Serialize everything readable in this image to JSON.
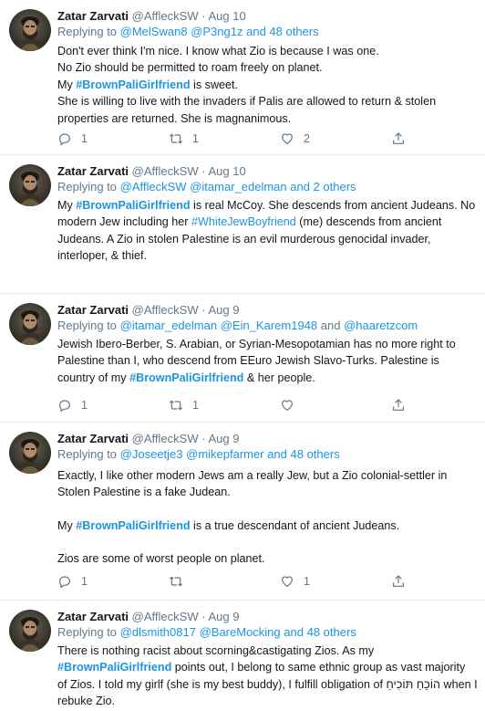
{
  "tweets": [
    {
      "name": "Zatar Zarvati",
      "handle": "@AffleckSW",
      "dot": "·",
      "date": "Aug 10",
      "reply_prefix": "Replying to ",
      "reply_users": [
        "@MelSwan8",
        "@P3ng1z"
      ],
      "reply_suffix": "and 48 others",
      "replies": "1",
      "retweets": "1",
      "likes": "2"
    },
    {
      "name": "Zatar Zarvati",
      "handle": "@AffleckSW",
      "dot": "·",
      "date": "Aug 10",
      "reply_prefix": "Replying to ",
      "reply_users": [
        "@AffleckSW",
        "@itamar_edelman"
      ],
      "reply_suffix": "and 2 others"
    },
    {
      "name": "Zatar Zarvati",
      "handle": "@AffleckSW",
      "dot": "·",
      "date": "Aug 9",
      "reply_prefix": "Replying to ",
      "reply_users": [
        "@itamar_edelman",
        "@Ein_Karem1948"
      ],
      "reply_and": "and",
      "reply_last": "@haaretzcom",
      "replies": "1",
      "retweets": "1",
      "likes": ""
    },
    {
      "name": "Zatar Zarvati",
      "handle": "@AffleckSW",
      "dot": "·",
      "date": "Aug 9",
      "reply_prefix": "Replying to ",
      "reply_users": [
        "@Joseetje3",
        "@mikepfarmer"
      ],
      "reply_suffix": "and 48 others",
      "replies": "1",
      "retweets": "",
      "likes": "1"
    },
    {
      "name": "Zatar Zarvati",
      "handle": "@AffleckSW",
      "dot": "·",
      "date": "Aug 9",
      "reply_prefix": "Replying to ",
      "reply_users": [
        "@dlsmith0817",
        "@BareMocking"
      ],
      "reply_suffix": "and 48 others"
    }
  ],
  "t1": {
    "l1": "Don't ever think I'm nice. I know what Zio is because I was  one.",
    "l2": "No Zio should be permitted to roam freely on planet.",
    "l3a": "My ",
    "l3tag": "#BrownPaliGirlfriend",
    "l3b": " is sweet.",
    "l4": "She is willing to live with the invaders if Palis are allowed to return & stolen properties are returned. She is magnanimous."
  },
  "t2": {
    "a": "My ",
    "tag1": "#BrownPaliGirlfriend",
    "b": " is real McCoy. She descends from ancient Judeans. No modern Jew including her ",
    "tag2": "#WhiteJewBoyfriend",
    "c": " (me) descends from ancient Judeans. A Zio in stolen Palestine is an evil murderous genocidal invader, interloper, & thief."
  },
  "t3": {
    "a": "Jewish Ibero-Berber, S. Arabian, or Syrian-Mesopotamian has no more right to Palestine than I, who descend from EEuro Jewish Slavo-Turks. Palestine is country of my ",
    "tag": "#BrownPaliGirlfriend",
    "b": " & her people."
  },
  "t4": {
    "p1": "Exactly, I like other modern Jews am a really Jew, but a Zio colonial-settler in Stolen Palestine is a fake Judean.",
    "p2a": "My ",
    "p2tag": "#BrownPaliGirlfriend",
    "p2b": " is a true descendant of ancient Judeans.",
    "p3": "Zios are some of worst people on planet."
  },
  "t5": {
    "a": "There is nothing racist about scorning&castigating Zios. As my ",
    "tag": "#BrownPaliGirlfriend",
    "b": " points out, I belong to same ethnic group as vast majority of Zios. I told my girlf (she is  my best buddy), I fulfill obligation of ",
    "hebrew": "הוֹכֵחַ תּוֹכִיחַ",
    "c": " when I rebuke Zio."
  },
  "icons": {
    "reply": "reply-icon",
    "retweet": "retweet-icon",
    "like": "heart-icon",
    "share": "share-icon"
  },
  "colors": {
    "link": "#1b95e0",
    "muted": "#657786",
    "text": "#14171a",
    "divider": "#e6ecf0"
  }
}
